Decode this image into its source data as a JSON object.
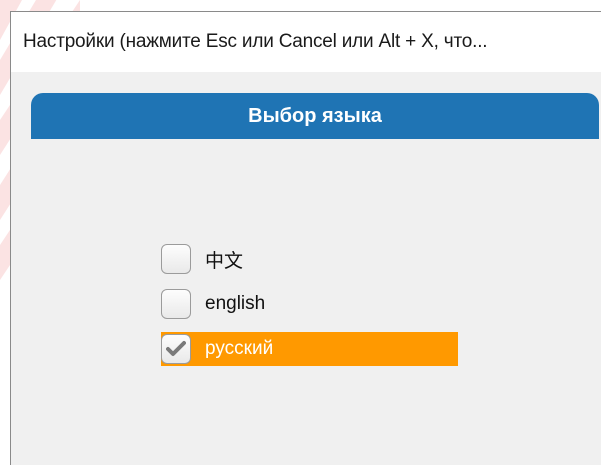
{
  "window": {
    "title": "Настройки (нажмите Esc или Cancel или Alt + X, что..."
  },
  "panel": {
    "title": "Выбор языка"
  },
  "languages": [
    {
      "label": "中文",
      "checked": false,
      "selected": false
    },
    {
      "label": "english",
      "checked": false,
      "selected": false
    },
    {
      "label": "русский",
      "checked": true,
      "selected": true
    }
  ],
  "icons": {
    "check": "check-icon"
  },
  "colors": {
    "header_blue": "#1f74b4",
    "selection_orange": "#ff9900",
    "window_bg": "#f0f0f0",
    "watermark_red": "#fbe3e3"
  }
}
